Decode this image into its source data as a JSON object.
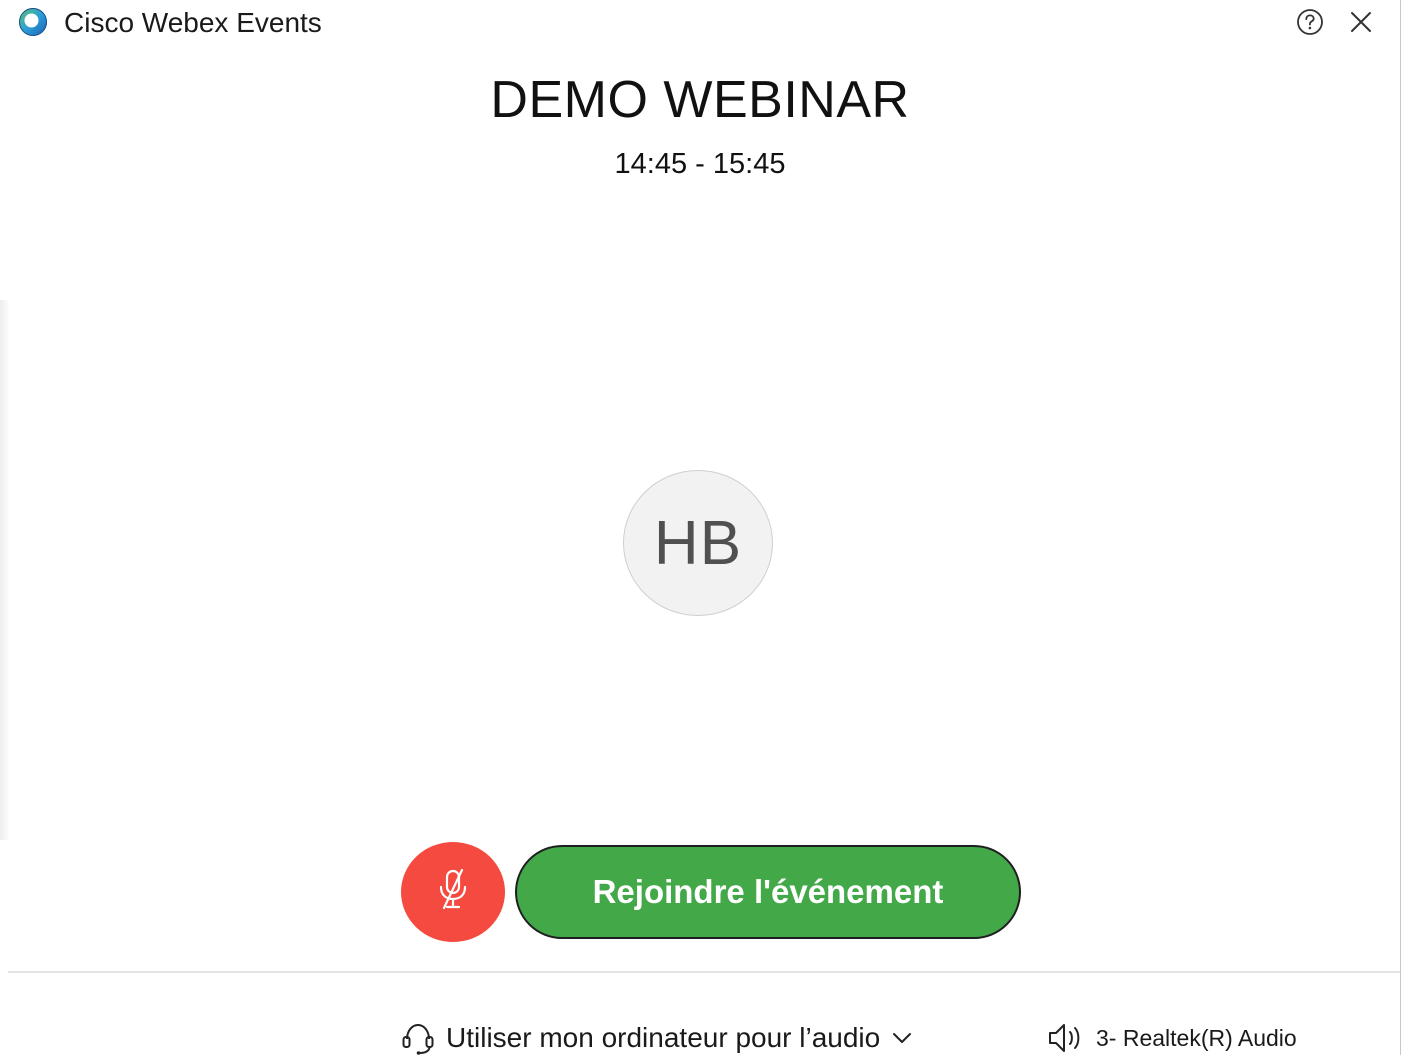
{
  "window": {
    "app_title": "Cisco Webex Events",
    "logo_icon": "webex-logo-icon",
    "help_icon": "help-icon",
    "close_icon": "close-icon"
  },
  "event": {
    "title": "DEMO WEBINAR",
    "time": "14:45 - 15:45"
  },
  "user": {
    "initials": "HB"
  },
  "controls": {
    "mute_icon": "microphone-muted-icon",
    "join_label": "Rejoindre l'événement"
  },
  "footer": {
    "audio_option": "Utiliser mon ordinateur pour l’audio",
    "audio_icon": "headset-icon",
    "speaker_device": "3- Realtek(R) Audio",
    "speaker_icon": "speaker-icon"
  },
  "colors": {
    "mute_button": "#f44a3f",
    "join_button": "#42a848"
  }
}
